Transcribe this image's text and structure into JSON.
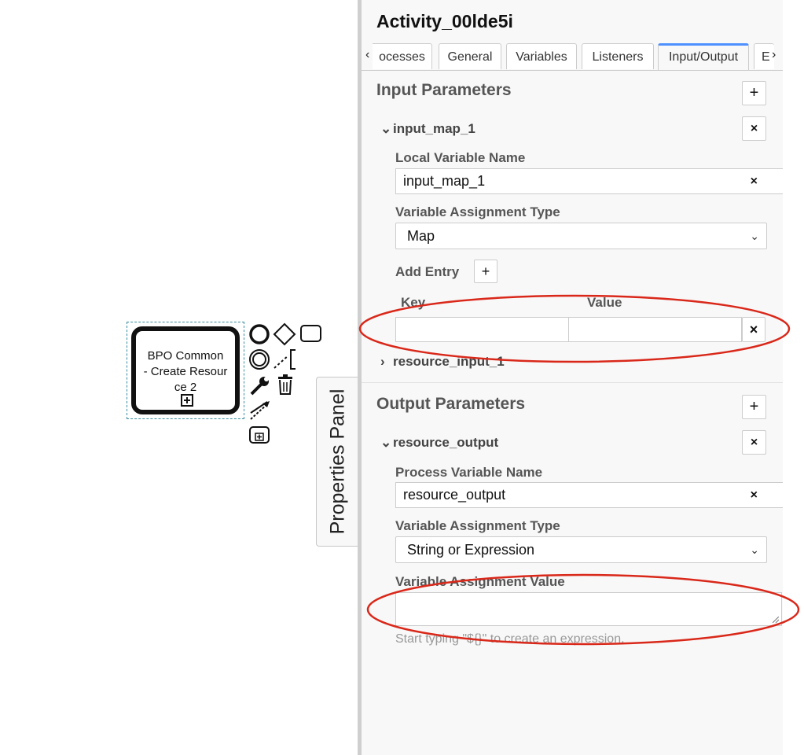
{
  "canvas": {
    "task_label": "BPO Common\n- Create Resour\nce 2"
  },
  "panel_toggle_label": "Properties Panel",
  "panel": {
    "title": "Activity_00lde5i",
    "tabs": [
      {
        "label": "ocesses"
      },
      {
        "label": "General"
      },
      {
        "label": "Variables"
      },
      {
        "label": "Listeners"
      },
      {
        "label": "Input/Output",
        "active": true
      },
      {
        "label": "E"
      }
    ],
    "tab_prev_icon": "chevron-left-icon",
    "tab_next_icon": "chevron-right-icon",
    "input_section": {
      "title": "Input Parameters",
      "add_symbol": "+",
      "parameter": {
        "name": "input_map_1",
        "remove_symbol": "×",
        "local_variable_label": "Local Variable Name",
        "local_variable_value": "input_map_1",
        "clear_symbol": "×",
        "assignment_type_label": "Variable Assignment Type",
        "assignment_type_value": "Map",
        "add_entry_label": "Add Entry",
        "add_entry_symbol": "+",
        "key_header": "Key",
        "value_header": "Value",
        "entry_key": "",
        "entry_value": "",
        "entry_remove_symbol": "×"
      },
      "collapsed_parameter": "resource_input_1"
    },
    "output_section": {
      "title": "Output Parameters",
      "add_symbol": "+",
      "parameter": {
        "name": "resource_output",
        "remove_symbol": "×",
        "process_variable_label": "Process Variable Name",
        "process_variable_value": "resource_output",
        "clear_symbol": "×",
        "assignment_type_label": "Variable Assignment Type",
        "assignment_type_value": "String or Expression",
        "assignment_value_label": "Variable Assignment Value",
        "assignment_value": "",
        "hint": "Start typing \"${}\" to create an expression."
      }
    }
  },
  "colors": {
    "annotation_ellipse": "#d9281a",
    "active_tab_accent": "#4d90fe",
    "selection_outline": "#3b8ea5"
  }
}
